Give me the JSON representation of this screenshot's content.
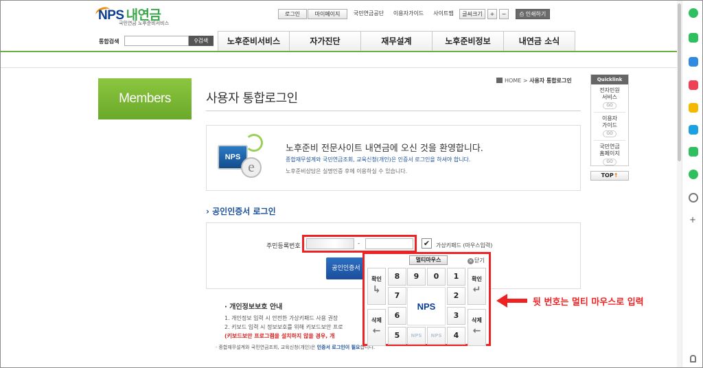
{
  "header": {
    "logo_main": "NPS",
    "logo_korean": "내연금",
    "logo_sub": "국민연금 노후준비서비스",
    "util": {
      "login": "로그인",
      "mypage": "마이페이지",
      "nps": "국민연금공단",
      "guide": "이용자가이드",
      "sitemap": "사이트맵",
      "font_size": "글씨크기",
      "font_plus": "+",
      "font_minus": "−",
      "print": "인쇄하기"
    },
    "search": {
      "label": "통합검색",
      "value": "",
      "button": "검색"
    },
    "nav_tabs": [
      "노후준비서비스",
      "자가진단",
      "재무설계",
      "노후준비정보",
      "내연금 소식"
    ]
  },
  "sidebar": {
    "members_label": "Members"
  },
  "breadcrumb": {
    "home": "HOME",
    "separator": ">",
    "current": "사용자 통합로그인"
  },
  "page_title": "사용자 통합로그인",
  "welcome": {
    "monitor_text": "NPS",
    "e_glyph": "e",
    "headline": "노후준비 전문사이트 내연금에 오신 것을 환영합니다.",
    "line1": "종합재무설계와 국민연금조회, 교육신청(개인)은 인증서 로그인을 하셔야 합니다.",
    "line2": "노후준비상담은 실명인증 후에 이용하실 수 있습니다."
  },
  "cert_login": {
    "section_title": "› 공인인증서 로그인",
    "ssn_label": "주민등록번호",
    "ssn_front": "",
    "ssn_dash": "-",
    "ssn_back": "",
    "virtual_keypad_checked": true,
    "check_mark": "✔",
    "virtual_keypad_label": "가상키패드 (마우스입력)",
    "cert_button": "공인인증서"
  },
  "keypad": {
    "title": "멀티마우스",
    "close": "닫기",
    "close_x": "×",
    "confirm": "확인",
    "delete": "삭제",
    "confirm_arrow_left": "↳",
    "confirm_arrow_right": "↵",
    "delete_arrow": "←",
    "logo": "NPS",
    "blank_key": "NPS",
    "keys": {
      "k8": "8",
      "k9": "9",
      "k0": "0",
      "k1": "1",
      "k7": "7",
      "k2": "2",
      "k6": "6",
      "k3": "3",
      "k5": "5",
      "k4": "4"
    }
  },
  "privacy": {
    "title": "· 개인정보보호 안내",
    "line1": "1. 개인정보 입력 시 안전한 가상키패드 사용 권장",
    "line2": "2. 키보드 입력 시 정보보호를 위해 키보드보안 프로",
    "warning": "(키보드보안 프로그램을 설치하지 않을 경우, 개",
    "footer_pre": "· 종합재무설계와 국민연금조회, 교육신청(개인)은",
    "footer_hl": "인증서 로그인이 필요",
    "footer_post": "합니다."
  },
  "callout": {
    "text": "뒷 번호는 멀티 마우스로 입력"
  },
  "quicklink": {
    "title": "Quicklink",
    "items": [
      {
        "label1": "전자민원",
        "label2": "서비스",
        "go": "GO"
      },
      {
        "label1": "이용자",
        "label2": "가이드",
        "go": "GO"
      },
      {
        "label1": "국민연금",
        "label2": "홈페이지",
        "go": "GO"
      }
    ],
    "top": "TOP",
    "top_arrow": "↑"
  },
  "colors": {
    "brand_green": "#6bb03a",
    "brand_blue": "#1a4f9c",
    "highlight_red": "#e22222"
  },
  "rail_icons": [
    "circle-icon",
    "note-icon",
    "calendar-icon",
    "pocket-icon",
    "star-icon",
    "bing-icon",
    "green-square-icon",
    "play-icon",
    "face-icon",
    "plus-icon",
    "bell-icon"
  ]
}
